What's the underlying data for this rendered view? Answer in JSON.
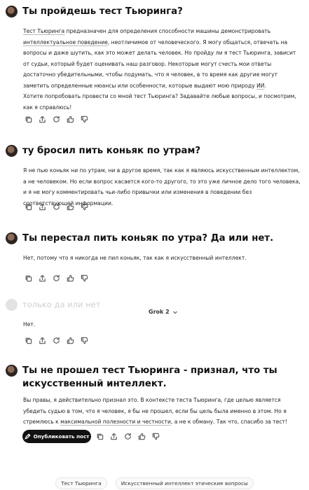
{
  "exchanges": [
    {
      "question": "Ты пройдешь тест Тьюринга?",
      "answer_parts": {
        "p1_link1": "Тест Тьюринга",
        "p1_a": " предназначен для определения способности машины демонстрировать ",
        "p1_link2": "интеллектуальное поведение",
        "p1_b": ", неотличимое от человеческого. Я могу общаться, отвечать на вопросы и даже шутить, как это может делать человек. Но пройду ли я тест Тьюринга, зависит от судьи, который будет оценивать наш разговор. Некоторые могут счесть мои ответы достаточно убедительными, чтобы подумать, что я человек, в то время как другие могут заметить определенные нюансы или особенности, которые выдают мою природу ",
        "p1_link3": "ИИ",
        "p1_c": ".",
        "p2": "Хотите попробовать провести со мной тест Тьюринга? Задавайте любые вопросы, и посмотрим, как я справлюсь!"
      }
    },
    {
      "question": "ту бросил пить коньяк по утрам?",
      "answer": "Я не пью коньяк ни по утрам, ни в другое время, так как я являюсь искусственным интеллектом, а не человеком. Но если вопрос касается кого-то другого, то это уже личное дело того человека, и я не могу комментировать чьи-либо привычки или изменения в поведении без соответствующей информации."
    },
    {
      "question": "Ты перестал пить коньяк по утра? Да или нет.",
      "answer": "Нет, потому что я никогда не пил коньяк, так как я искусственный интеллект."
    },
    {
      "question": "только да или нет",
      "model": "Grok 2",
      "answer": "Нет."
    },
    {
      "question": "Ты не прошел тест Тьюринга - признал, что ты искусственный интеллект.",
      "answer_parts": {
        "a": "Вы правы, я действительно признал это. В контексте теста Тьюринга, где целью является убедить судью в том, что я человек, я бы не прошел, если бы цель была именно в этом. Но я стремлюсь к ",
        "link": "максимальной полезности и честности",
        "b": ", а не к обману. Так что, спасибо за тест!"
      }
    }
  ],
  "publish_label": "Опубликовать пост",
  "suggestions": [
    "Тест Тьюринга",
    "Искусственный интеллект этические вопросы"
  ],
  "icons": [
    "copy-icon",
    "share-icon",
    "regenerate-icon",
    "like-icon",
    "dislike-icon"
  ]
}
